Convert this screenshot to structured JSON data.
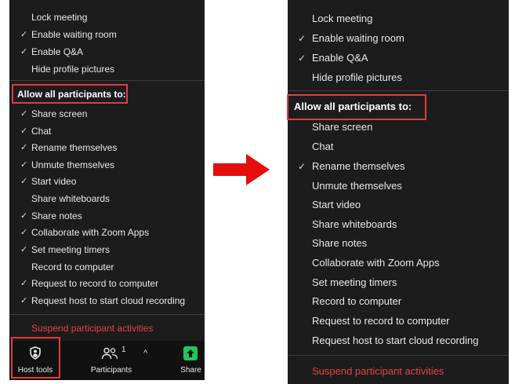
{
  "left": {
    "security_items": [
      {
        "label": "Lock meeting",
        "checked": false
      },
      {
        "label": "Enable waiting room",
        "checked": true
      },
      {
        "label": "Enable Q&A",
        "checked": true
      },
      {
        "label": "Hide profile pictures",
        "checked": false
      }
    ],
    "allow_header": "Allow all participants to:",
    "permissions": [
      {
        "label": "Share screen",
        "checked": true
      },
      {
        "label": "Chat",
        "checked": true
      },
      {
        "label": "Rename themselves",
        "checked": true
      },
      {
        "label": "Unmute themselves",
        "checked": true
      },
      {
        "label": "Start video",
        "checked": true
      },
      {
        "label": "Share whiteboards",
        "checked": false
      },
      {
        "label": "Share notes",
        "checked": true
      },
      {
        "label": "Collaborate with Zoom Apps",
        "checked": true
      },
      {
        "label": "Set meeting timers",
        "checked": true
      },
      {
        "label": "Record to computer",
        "checked": false
      },
      {
        "label": "Request to record to computer",
        "checked": true
      },
      {
        "label": "Request host to start cloud recording",
        "checked": true
      }
    ],
    "suspend_label": "Suspend participant activities",
    "toolbar": {
      "host_tools_label": "Host tools",
      "participants_label": "Participants",
      "participants_count": "1",
      "share_label": "Share"
    }
  },
  "right": {
    "security_items": [
      {
        "label": "Lock meeting",
        "checked": false
      },
      {
        "label": "Enable waiting room",
        "checked": true
      },
      {
        "label": "Enable Q&A",
        "checked": true
      },
      {
        "label": "Hide profile pictures",
        "checked": false
      }
    ],
    "allow_header": "Allow all participants to:",
    "permissions": [
      {
        "label": "Share screen",
        "checked": false
      },
      {
        "label": "Chat",
        "checked": false
      },
      {
        "label": "Rename themselves",
        "checked": true
      },
      {
        "label": "Unmute themselves",
        "checked": false
      },
      {
        "label": "Start video",
        "checked": false
      },
      {
        "label": "Share whiteboards",
        "checked": false
      },
      {
        "label": "Share notes",
        "checked": false
      },
      {
        "label": "Collaborate with Zoom Apps",
        "checked": false
      },
      {
        "label": "Set meeting timers",
        "checked": false
      },
      {
        "label": "Record to computer",
        "checked": false
      },
      {
        "label": "Request to record to computer",
        "checked": false
      },
      {
        "label": "Request host to start cloud recording",
        "checked": false
      }
    ],
    "suspend_label": "Suspend participant activities"
  },
  "check_glyph": "✓",
  "colors": {
    "panel_bg": "#1c1c1c",
    "highlight": "#e53b3b",
    "danger_text": "#e0463f",
    "share_green": "#21c65a",
    "arrow_red": "#e60d0d"
  }
}
